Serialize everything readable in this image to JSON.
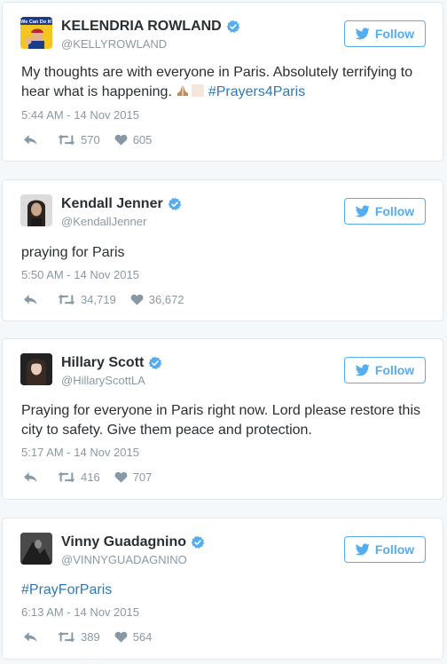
{
  "colors": {
    "accent": "#55acee",
    "link": "#2b7bb9",
    "meta": "#8899a6",
    "text": "#292f33"
  },
  "follow_label": "Follow",
  "tweets": [
    {
      "name": "KELENDRIA ROWLAND",
      "handle": "@KELLYROWLAND",
      "avatar_text": "We Can Do It!",
      "text_before": "My thoughts are with everyone in Paris. Absolutely terrifying to hear what is happening.",
      "hashtag": "#Prayers4Paris",
      "timestamp": "5:44 AM - 14 Nov 2015",
      "retweets": "570",
      "likes": "605"
    },
    {
      "name": "Kendall Jenner",
      "handle": "@KendallJenner",
      "text": "praying for Paris",
      "timestamp": "5:50 AM - 14 Nov 2015",
      "retweets": "34,719",
      "likes": "36,672"
    },
    {
      "name": "Hillary Scott",
      "handle": "@HillaryScottLA",
      "text": "Praying for everyone in Paris right now. Lord please restore this city to safety. Give them peace and protection.",
      "timestamp": "5:17 AM - 14 Nov 2015",
      "retweets": "416",
      "likes": "707"
    },
    {
      "name": "Vinny Guadagnino",
      "handle": "@VINNYGUADAGNINO",
      "hashtag": "#PrayForParis",
      "timestamp": "6:13 AM - 14 Nov 2015",
      "retweets": "389",
      "likes": "564"
    }
  ]
}
